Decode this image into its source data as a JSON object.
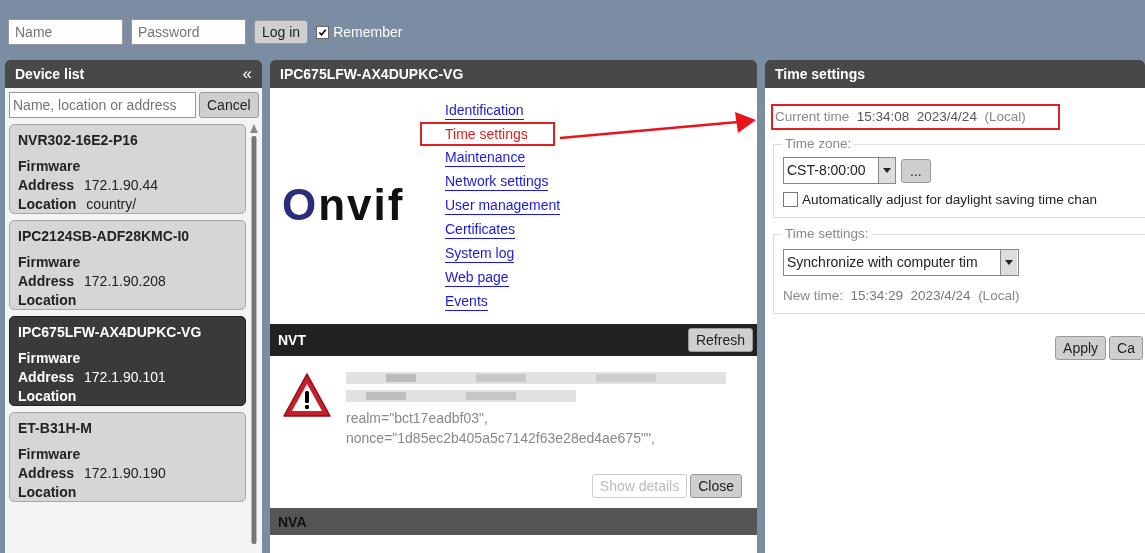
{
  "login": {
    "name_placeholder": "Name",
    "password_placeholder": "Password",
    "button": "Log in",
    "remember": {
      "label": "Remember",
      "checked": true
    }
  },
  "device_list": {
    "title": "Device list",
    "collapse": "«",
    "search_placeholder": "Name, location or address",
    "cancel": "Cancel",
    "devices": [
      {
        "name": "NVR302-16E2-P16",
        "selected": false,
        "fields": [
          {
            "label": "Firmware"
          },
          {
            "label": "Address",
            "value": "172.1.90.44"
          },
          {
            "label": "Location",
            "value": "country/"
          }
        ]
      },
      {
        "name": "IPC2124SB-ADF28KMC-I0",
        "selected": false,
        "fields": [
          {
            "label": "Firmware"
          },
          {
            "label": "Address",
            "value": "172.1.90.208"
          },
          {
            "label": "Location"
          }
        ]
      },
      {
        "name": "IPC675LFW-AX4DUPKC-VG",
        "selected": true,
        "fields": [
          {
            "label": "Firmware"
          },
          {
            "label": "Address",
            "value": "172.1.90.101"
          },
          {
            "label": "Location"
          }
        ]
      },
      {
        "name": "ET-B31H-M",
        "selected": false,
        "fields": [
          {
            "label": "Firmware"
          },
          {
            "label": "Address",
            "value": "172.1.90.190"
          },
          {
            "label": "Location"
          }
        ]
      }
    ]
  },
  "device_panel": {
    "title": "IPC675LFW-AX4DUPKC-VG",
    "logo": "Onvif",
    "menu": [
      {
        "label": "Identification",
        "highlighted": false
      },
      {
        "label": "Time settings",
        "highlighted": true
      },
      {
        "label": "Maintenance",
        "highlighted": false
      },
      {
        "label": "Network settings",
        "highlighted": false
      },
      {
        "label": "User management",
        "highlighted": false
      },
      {
        "label": "Certificates",
        "highlighted": false
      },
      {
        "label": "System log",
        "highlighted": false
      },
      {
        "label": "Web page",
        "highlighted": false
      },
      {
        "label": "Events",
        "highlighted": false
      }
    ]
  },
  "nvt": {
    "title": "NVT",
    "refresh": "Refresh",
    "message_lines": [
      "realm=\"bct17eadbf03\",",
      "nonce=\"1d85ec2b405a5c7142f63e28ed4ae675\"\","
    ],
    "buttons": [
      {
        "label": "Show details",
        "disabled": true
      },
      {
        "label": "Close",
        "disabled": false
      }
    ]
  },
  "nva": {
    "title": "NVA"
  },
  "time_settings": {
    "title": "Time settings",
    "current_time": {
      "label": "Current time",
      "time": "15:34:08",
      "date": "2023/4/24",
      "zone": "(Local)",
      "highlighted": true
    },
    "time_zone": {
      "legend": "Time zone:",
      "value": "CST-8:00:00",
      "more": "...",
      "dst": {
        "label": "Automatically adjust for daylight saving time chan",
        "checked": false
      }
    },
    "sync": {
      "legend": "Time settings:",
      "value": "Synchronize with computer tim",
      "new_time": {
        "label": "New time:",
        "time": "15:34:29",
        "date": "2023/4/24",
        "zone": "(Local)"
      }
    },
    "buttons": [
      "Apply",
      "Ca"
    ]
  }
}
